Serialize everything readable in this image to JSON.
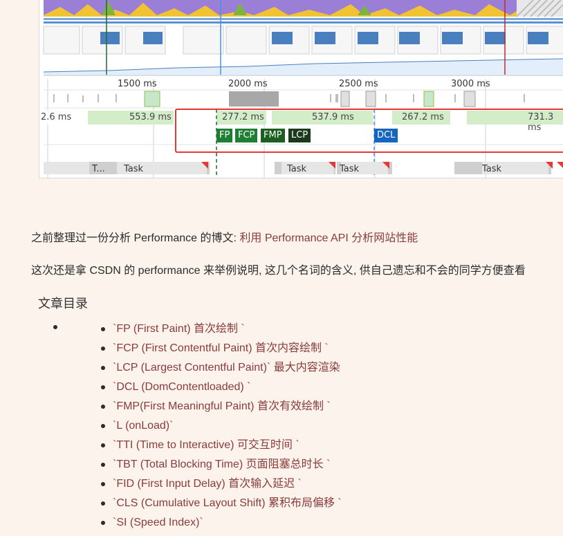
{
  "timeline": {
    "ruler": [
      "1500 ms",
      "2000 ms",
      "2500 ms",
      "3000 ms"
    ],
    "segments": [
      "2.6 ms",
      "553.9 ms",
      "277.2 ms",
      "537.9 ms",
      "267.2 ms",
      "731.3 ms"
    ],
    "markers": [
      {
        "label": "FP",
        "color": "#1e7e34"
      },
      {
        "label": "FCP",
        "color": "#1e7e34"
      },
      {
        "label": "FMP",
        "color": "#1b5e20"
      },
      {
        "label": "LCP",
        "color": "#1b3a1b"
      },
      {
        "label": "DCL",
        "color": "#1565c0"
      }
    ],
    "tasks": [
      "T...",
      "Task",
      "Task",
      "Task",
      "Task"
    ]
  },
  "article": {
    "intro_text": "之前整理过一份分析 Performance 的博文: ",
    "intro_link": "利用 Performance API 分析网站性能",
    "second_text": "这次还是拿 CSDN 的 performance 来举例说明, 这几个名词的含义, 供自己遗忘和不会的同学方便查看",
    "toc_title": "文章目录",
    "toc_items": [
      "`FP (First Paint) 首次绘制 `",
      "`FCP (First Contentful Paint) 首次内容绘制 `",
      "`LCP (Largest Contentful Paint)` 最大内容渲染",
      "`DCL (DomContentloaded) `",
      "`FMP(First Meaningful Paint) 首次有效绘制 `",
      "`L (onLoad)`",
      "`TTI (Time to Interactive) 可交互时间 `",
      "`TBT (Total Blocking Time) 页面阻塞总时长 `",
      "`FID (First Input Delay) 首次输入延迟 `",
      "`CLS (Cumulative Layout Shift) 累积布局偏移 `",
      "`SI (Speed Index)`"
    ]
  }
}
